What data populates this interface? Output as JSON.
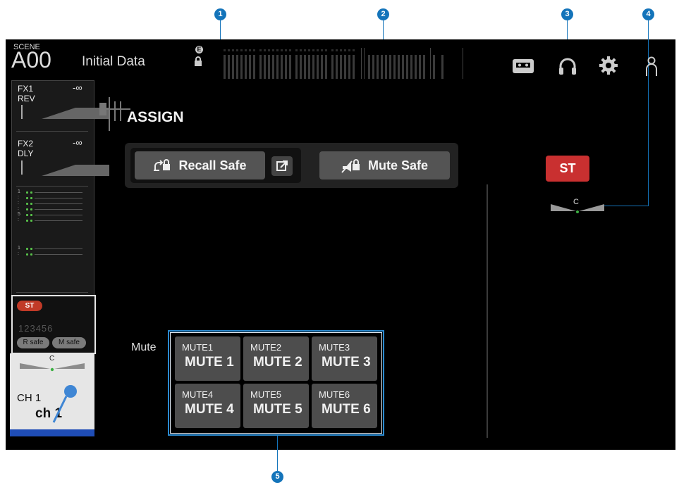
{
  "callouts": [
    "1",
    "2",
    "3",
    "4",
    "5"
  ],
  "header": {
    "scene_label": "SCENE",
    "scene_number": "A00",
    "scene_name": "Initial Data",
    "e_badge": "E"
  },
  "toolbar_icons": [
    "recorder-icon",
    "headphones-icon",
    "gear-icon",
    "user-icon"
  ],
  "channel_strip": {
    "fx1": {
      "name": "FX1",
      "level": "-∞",
      "type": "REV"
    },
    "fx2": {
      "name": "FX2",
      "level": "-∞",
      "type": "DLY"
    },
    "meter_labels": [
      "1",
      ":",
      ":",
      ":",
      "5",
      ":",
      "1",
      ":"
    ],
    "st_badge": "ST",
    "mute_group_numbers": "123456",
    "recall_safe_pill": "R safe",
    "mute_safe_pill": "M safe",
    "pan_label": "C",
    "channel_name": "CH 1",
    "channel_label": "ch 1"
  },
  "main": {
    "title": "ASSIGN",
    "recall_safe_label": "Recall Safe",
    "mute_safe_label": "Mute Safe",
    "st_button_label": "ST",
    "pan_label": "C",
    "mute_section_label": "Mute",
    "mute_buttons": [
      {
        "group": "MUTE1",
        "name": "MUTE 1"
      },
      {
        "group": "MUTE2",
        "name": "MUTE 2"
      },
      {
        "group": "MUTE3",
        "name": "MUTE 3"
      },
      {
        "group": "MUTE4",
        "name": "MUTE 4"
      },
      {
        "group": "MUTE5",
        "name": "MUTE 5"
      },
      {
        "group": "MUTE6",
        "name": "MUTE 6"
      }
    ]
  },
  "colors": {
    "callout": "#1474ba",
    "st_red": "#c93030",
    "channel_blue": "#1f4db6",
    "meter_green": "#58c24a"
  }
}
